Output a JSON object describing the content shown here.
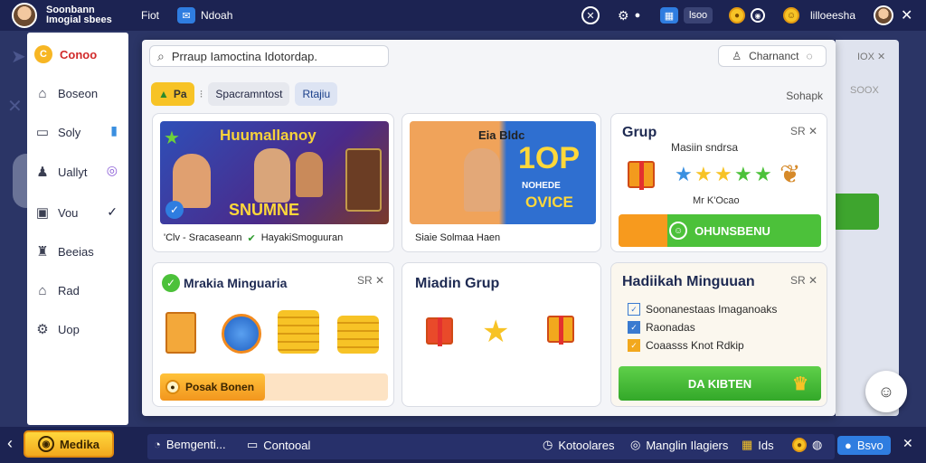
{
  "topbar": {
    "brand_line1": "Soonbann",
    "brand_line2": "Imogial sbees",
    "item1": "Fiot",
    "item2": "Ndoah",
    "chip1": "lsoo",
    "item3": "lilloeesha",
    "close": "✕"
  },
  "sidebar": {
    "items": [
      {
        "label": "Conoo",
        "icon": "coin-icon"
      },
      {
        "label": "Boseon",
        "icon": "home-icon"
      },
      {
        "label": "Soly",
        "icon": "monitor-icon"
      },
      {
        "label": "Uallyt",
        "icon": "user-icon"
      },
      {
        "label": "Vou",
        "icon": "calendar-icon"
      },
      {
        "label": "Beeias",
        "icon": "people-icon"
      },
      {
        "label": "Rad",
        "icon": "house-icon"
      },
      {
        "label": "Uop",
        "icon": "settings-icon"
      }
    ]
  },
  "modal": {
    "search_text": "Prraup Iamoctina Idotordap.",
    "comment_label": "Charnanct",
    "tabs": [
      {
        "label": "Pa"
      },
      {
        "label": "Spacramntost"
      },
      {
        "label": "Rtajiu"
      }
    ],
    "sort_label": "Sohapk",
    "back_label": "IOX",
    "back_label2": "SOOX"
  },
  "cards": {
    "card1": {
      "banner_title": "Huumallanoy",
      "banner_bottom": "SNUMNE",
      "caption_a": "'Clv - Sracaseann",
      "caption_b": "HayakiSmoguuran"
    },
    "card2": {
      "banner_top": "Eia Bldc",
      "banner_big": "1OP",
      "banner_sub1": "NOHEDE",
      "banner_sub2": "OVICE",
      "caption": "Siaie Solmaa Haen"
    },
    "card3": {
      "title": "Grup",
      "close": "SR ✕",
      "subtitle": "Masiin sndrsa",
      "mid": "Mr K'Ocao",
      "button": "OHUNSBENU"
    },
    "card4": {
      "title": "Mrakia Minguaria",
      "close": "SR ✕",
      "button": "Posak Bonen"
    },
    "card5": {
      "title": "Miadin Grup"
    },
    "card6": {
      "title": "Hadiikah Minguuan",
      "close": "SR ✕",
      "list": [
        "Soonanestaas Imaganoaks",
        "Raonadas",
        "Coaasss Knot Rdkip"
      ],
      "button": "DA KIBTEN"
    }
  },
  "bottombar": {
    "medika": "Medika",
    "b1": "Bemgenti...",
    "b2": "Contooal",
    "b3": "Kotoolares",
    "b4": "Manglin Ilagiers",
    "b5": "Ids",
    "b6": "Bsvo"
  }
}
